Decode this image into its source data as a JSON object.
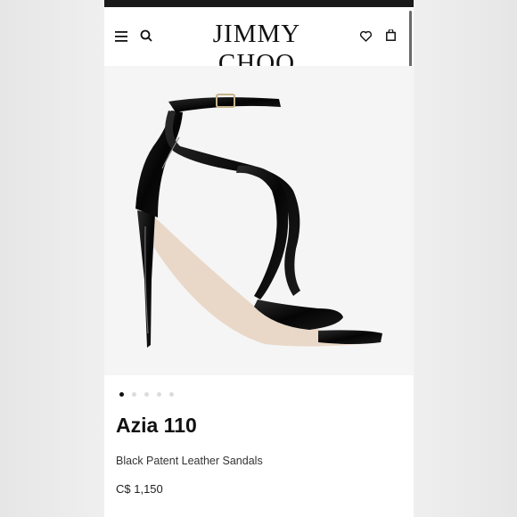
{
  "header": {
    "brand": "JIMMY CHOO",
    "icons": [
      "menu-icon",
      "search-icon",
      "heart-icon",
      "shopping-bag-icon"
    ]
  },
  "gallery": {
    "image_count": 5,
    "active_index": 0
  },
  "product": {
    "name": "Azia 110",
    "description": "Black Patent Leather Sandals",
    "price": "C$ 1,150"
  },
  "colors": {
    "text": "#111111",
    "image_bg": "#f5f5f5",
    "dot_active": "#111111",
    "dot_inactive": "#dcdcdc"
  }
}
